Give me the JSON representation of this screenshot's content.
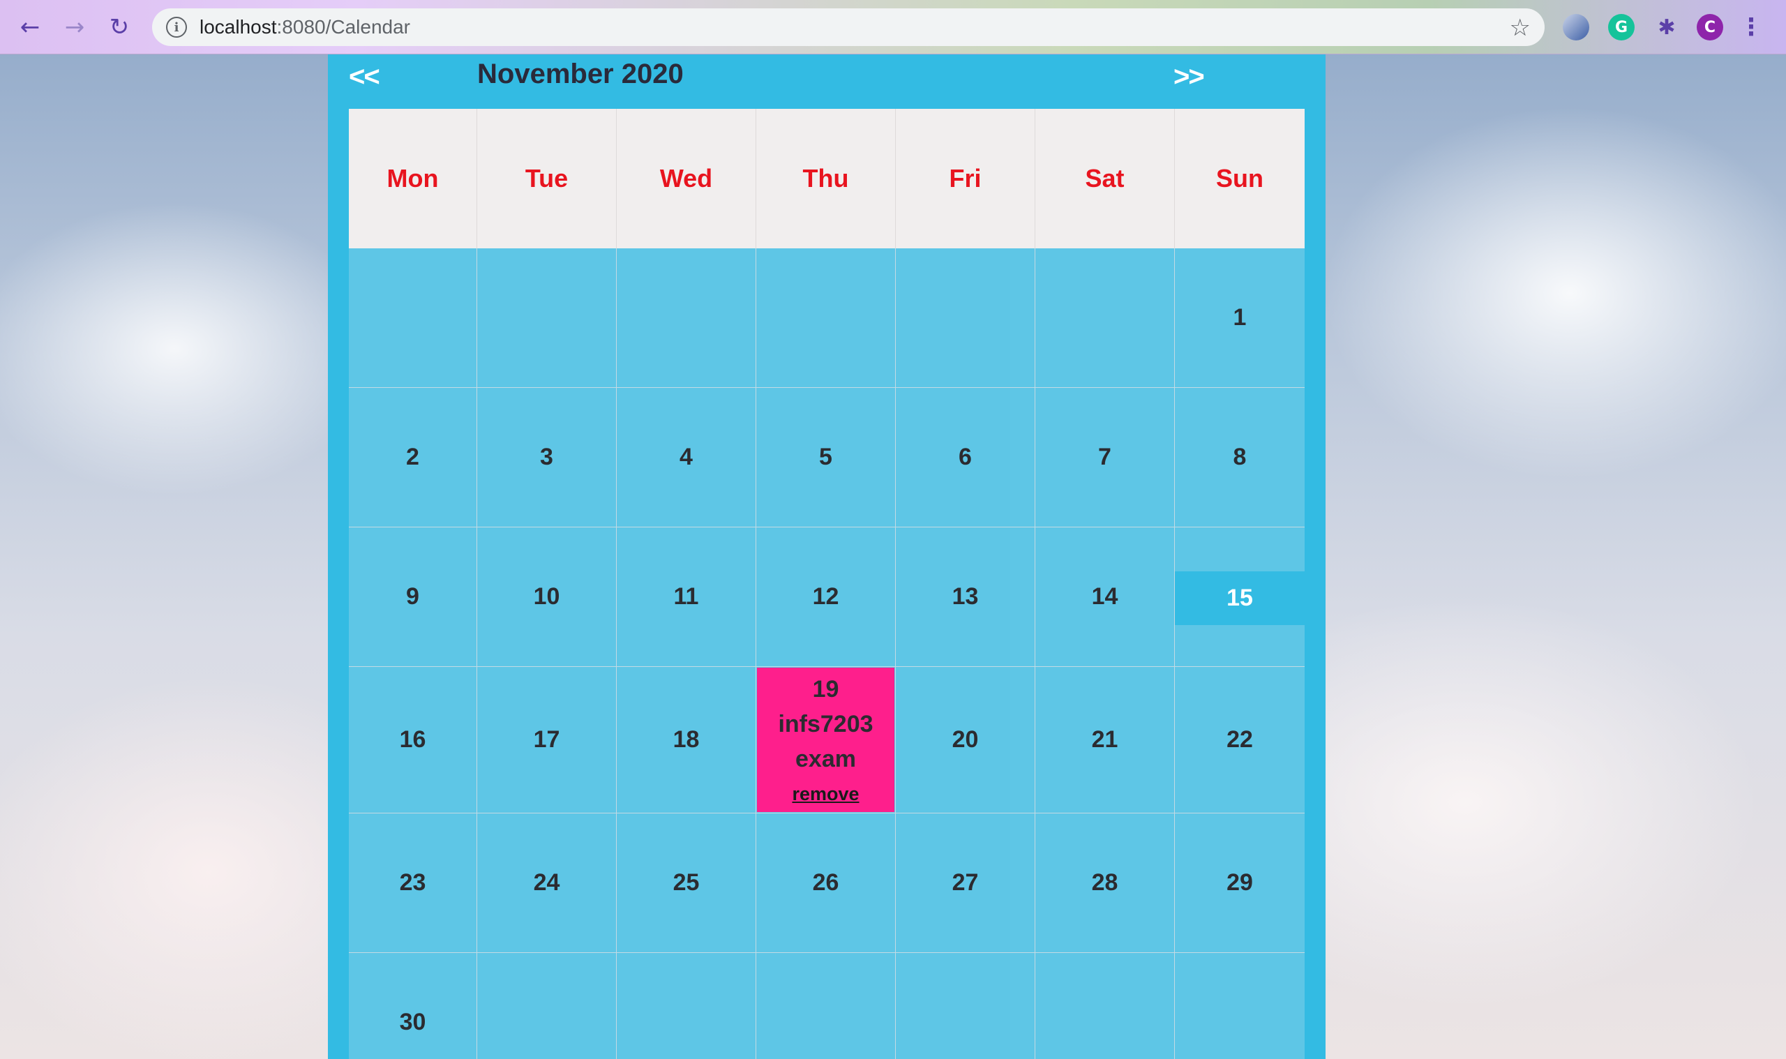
{
  "browser": {
    "url_host": "localhost",
    "url_rest": ":8080/Calendar",
    "back_icon": "arrow-left-icon",
    "forward_icon": "arrow-right-icon",
    "reload_icon": "reload-icon",
    "star_icon": "star-icon",
    "profile_initial": "C",
    "grammarly_initial": "G"
  },
  "calendar": {
    "title": "November 2020",
    "prev_label": "<<",
    "next_label": ">>",
    "weekdays": [
      "Mon",
      "Tue",
      "Wed",
      "Thu",
      "Fri",
      "Sat",
      "Sun"
    ],
    "weeks": [
      [
        "",
        "",
        "",
        "",
        "",
        "",
        "1"
      ],
      [
        "2",
        "3",
        "4",
        "5",
        "6",
        "7",
        "8"
      ],
      [
        "9",
        "10",
        "11",
        "12",
        "13",
        "14",
        "15"
      ],
      [
        "16",
        "17",
        "18",
        "19",
        "20",
        "21",
        "22"
      ],
      [
        "23",
        "24",
        "25",
        "26",
        "27",
        "28",
        "29"
      ],
      [
        "30",
        "",
        "",
        "",
        "",
        "",
        ""
      ]
    ],
    "today": "15",
    "event": {
      "day": "19",
      "title": "infs7203 exam",
      "remove_label": "remove",
      "color": "#fe1f8c"
    },
    "accent_color": "#33bbe3",
    "weekday_color": "#e8141f"
  }
}
